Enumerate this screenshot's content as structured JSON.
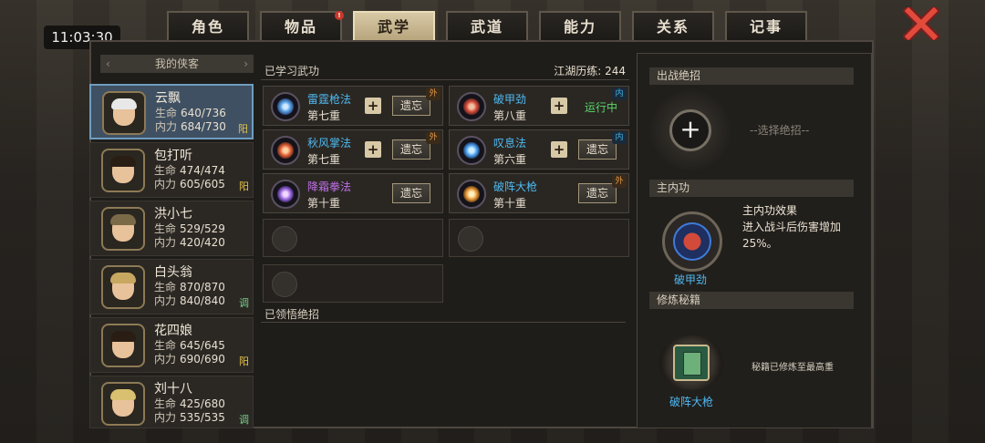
{
  "clock": "11:03:30",
  "tabs": [
    {
      "label": "角色",
      "active": false,
      "badge": false
    },
    {
      "label": "物品",
      "active": false,
      "badge": true,
      "badge_text": "!"
    },
    {
      "label": "武学",
      "active": true,
      "badge": false
    },
    {
      "label": "武道",
      "active": false,
      "badge": false
    },
    {
      "label": "能力",
      "active": false,
      "badge": false
    },
    {
      "label": "关系",
      "active": false,
      "badge": false
    },
    {
      "label": "记事",
      "active": false,
      "badge": false
    }
  ],
  "sidebar": {
    "title": "我的侠客",
    "heroes": [
      {
        "name": "云飘",
        "hp_label": "生命",
        "hp": "640/736",
        "mp_label": "内力",
        "mp": "684/730",
        "tag": "阳",
        "selected": true
      },
      {
        "name": "包打听",
        "hp_label": "生命",
        "hp": "474/474",
        "mp_label": "内力",
        "mp": "605/605",
        "tag": "阳",
        "selected": false
      },
      {
        "name": "洪小七",
        "hp_label": "生命",
        "hp": "529/529",
        "mp_label": "内力",
        "mp": "420/420",
        "tag": "",
        "selected": false
      },
      {
        "name": "白头翁",
        "hp_label": "生命",
        "hp": "870/870",
        "mp_label": "内力",
        "mp": "840/840",
        "tag": "调",
        "selected": false
      },
      {
        "name": "花四娘",
        "hp_label": "生命",
        "hp": "645/645",
        "mp_label": "内力",
        "mp": "690/690",
        "tag": "阳",
        "selected": false
      },
      {
        "name": "刘十八",
        "hp_label": "生命",
        "hp": "425/680",
        "mp_label": "内力",
        "mp": "535/535",
        "tag": "调",
        "selected": false
      }
    ]
  },
  "learned": {
    "title": "已学习武功",
    "experience_label": "江湖历练: 244",
    "forget_label": "遗忘",
    "running_label": "运行中",
    "plus_label": "+",
    "skills": [
      {
        "name": "雷霆枪法",
        "level": "第七重",
        "corner": "外",
        "name_color": "#4fb8f0",
        "icon_color": "#5fa8e8",
        "has_plus": true,
        "running": false
      },
      {
        "name": "破甲劲",
        "level": "第八重",
        "corner": "内",
        "name_color": "#4fb8f0",
        "icon_color": "#d24a3a",
        "has_plus": true,
        "running": true
      },
      {
        "name": "秋风掌法",
        "level": "第七重",
        "corner": "外",
        "name_color": "#4fb8f0",
        "icon_color": "#e0603a",
        "has_plus": true,
        "running": false
      },
      {
        "name": "叹息法",
        "level": "第六重",
        "corner": "内",
        "name_color": "#4fb8f0",
        "icon_color": "#4fa0f0",
        "has_plus": true,
        "running": false
      },
      {
        "name": "降霜拳法",
        "level": "第十重",
        "corner": "外",
        "name_color": "#c070e8",
        "icon_color": "#9a6ae0",
        "has_plus": false,
        "running": false
      },
      {
        "name": "破阵大枪",
        "level": "第十重",
        "corner": "外",
        "name_color": "#4fb8f0",
        "icon_color": "#e89a3a",
        "has_plus": false,
        "running": false
      }
    ]
  },
  "comprehended_title": "已领悟绝招",
  "right": {
    "ultimate_title": "出战绝招",
    "ultimate_plus": "+",
    "ultimate_hint": "--选择绝招--",
    "neigong_title": "主内功",
    "neigong_name": "破甲劲",
    "effect_title": "主内功效果",
    "effect_desc": "进入战斗后伤害增加25%。",
    "book_title": "修炼秘籍",
    "book_name": "破阵大枪",
    "book_desc": "秘籍已修炼至最高重"
  }
}
